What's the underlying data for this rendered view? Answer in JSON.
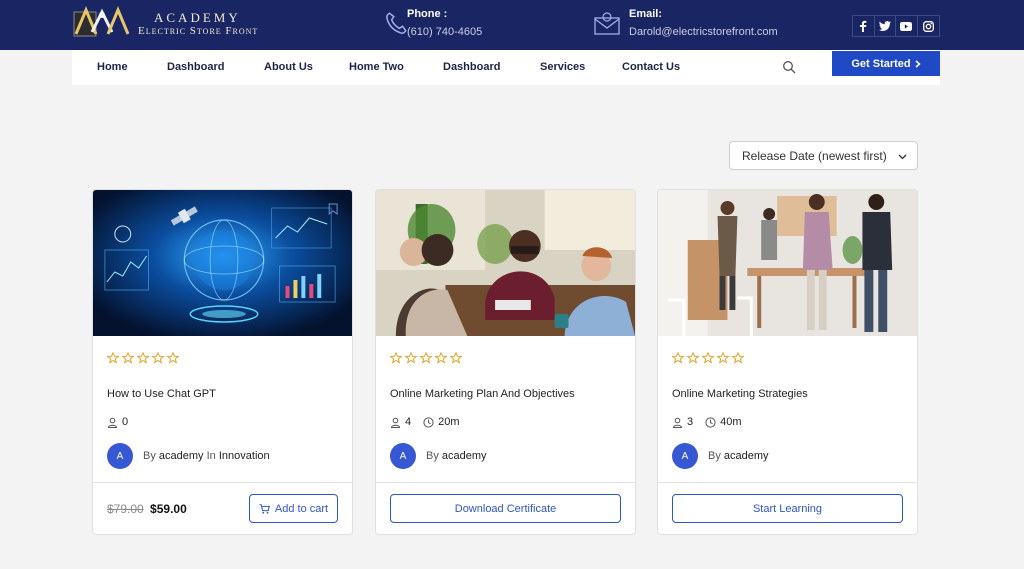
{
  "brand": {
    "line1": "ACADEMY",
    "line2": "Electric Store Front"
  },
  "contact": {
    "phone": {
      "label": "Phone :",
      "value": "(610) 740-4605"
    },
    "email": {
      "label": "Email:",
      "value": "Darold@electricstorefront.com"
    }
  },
  "social": [
    "facebook-icon",
    "twitter-icon",
    "youtube-icon",
    "instagram-icon"
  ],
  "nav": {
    "items": [
      "Home",
      "Dashboard",
      "About Us",
      "Home Two",
      "Dashboard",
      "Services",
      "Contact Us"
    ],
    "cta": "Get Started"
  },
  "sort": {
    "selected": "Release Date (newest first)"
  },
  "courses": [
    {
      "title": "How to Use Chat GPT",
      "students": "0",
      "duration": "",
      "avatar": "A",
      "by": "By",
      "author": "academy",
      "in": "In",
      "category": "Innovation",
      "old_price": "$79.00",
      "price": "$59.00",
      "action": "Add to cart"
    },
    {
      "title": "Online Marketing Plan And Objectives",
      "students": "4",
      "duration": "20m",
      "avatar": "A",
      "by": "By",
      "author": "academy",
      "action": "Download Certificate"
    },
    {
      "title": "Online Marketing Strategies",
      "students": "3",
      "duration": "40m",
      "avatar": "A",
      "by": "By",
      "author": "academy",
      "action": "Start Learning"
    }
  ],
  "colors": {
    "header": "#1a2664",
    "accent": "#1f49c5",
    "star": "#e0a42a"
  }
}
